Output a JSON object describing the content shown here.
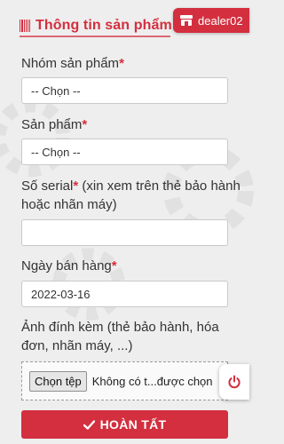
{
  "header": {
    "title": "Thông tin sản phẩm",
    "user": "dealer02"
  },
  "form": {
    "product_group": {
      "label": "Nhóm sản phẩm",
      "required": "*",
      "value": "-- Chọn --"
    },
    "product": {
      "label": "Sản phẩm",
      "required": "*",
      "value": "-- Chọn --"
    },
    "serial": {
      "label": "Số serial",
      "required": "*",
      "hint_line1": " (xin xem trên thẻ bảo hành",
      "hint_line2": "hoặc nhãn máy)",
      "value": ""
    },
    "sale_date": {
      "label": "Ngày bán hàng",
      "required": "*",
      "value": "2022-03-16"
    },
    "attachment": {
      "label_line1": "Ảnh đính kèm (thẻ bảo hành, hóa",
      "label_line2": "đơn, nhãn máy, ...)",
      "button": "Chọn tệp",
      "file_name": "Không có t...được chọn"
    },
    "submit": "HOÀN TẤT"
  },
  "colors": {
    "accent": "#d32f3f",
    "background": "#eeeeee"
  },
  "icons": {
    "title_icon": "barcode-icon",
    "user_icon": "store-icon",
    "fab_icon": "power-icon",
    "submit_icon": "check-icon"
  }
}
